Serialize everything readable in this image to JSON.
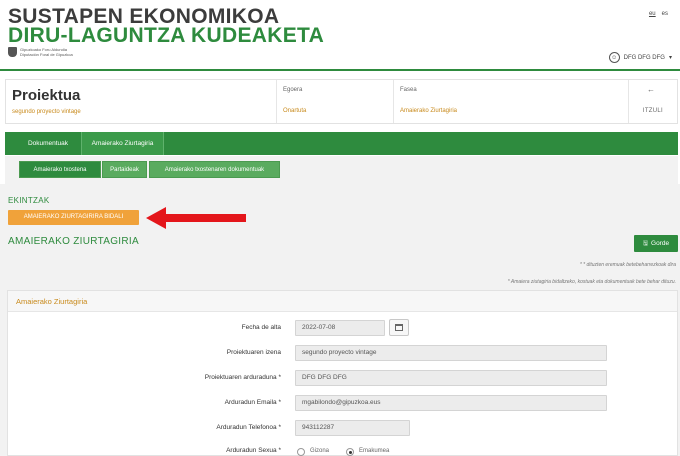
{
  "header": {
    "title_line1": "SUSTAPEN EKONOMIKOA",
    "title_line2": "DIRU-LAGUNTZA KUDEAKETA",
    "logo_line1": "Gipuzkoako Foru Aldundia",
    "logo_line2": "Diputación Foral de Gipuzkoa",
    "lang_eu": "eu",
    "lang_es": "es",
    "user_name": "DFG DFG DFG",
    "user_caret": "▾"
  },
  "project": {
    "title": "Proiektua",
    "subtitle": "segundo proyecto vintage",
    "state_label": "Egoera",
    "state_value": "Onartuta",
    "phase_label": "Fasea",
    "phase_value": "Amaierako Ziurtagiria",
    "back_arrow": "←",
    "back_label": "ITZULI"
  },
  "tabs": [
    {
      "label": "Dokumentuak",
      "active": false
    },
    {
      "label": "Amaierako Ziurtagiria",
      "active": true
    }
  ],
  "subtabs": [
    {
      "label": "Amaierako txostena",
      "active": true
    },
    {
      "label": "Partaideak",
      "active": false
    },
    {
      "label": "Amaierako txostenaren dokumentuak",
      "active": false
    }
  ],
  "actions": {
    "heading": "EKINTZAK",
    "send_button": "AMAIERAKO ZIURTAGIRIRA BIDALI"
  },
  "section": {
    "title": "AMAIERAKO ZIURTAGIRIA",
    "save_icon": "🖫",
    "save_label": "Gorde",
    "note_required": "* * dituzten eremuak betebeharrezkoak dira",
    "note_docs": "* Amaiera ziutagiria bidaltzeko, kostuak eta dokumentuak bete behar dituzu."
  },
  "form": {
    "panel_title": "Amaierako Ziurtagiria",
    "fields": [
      {
        "label": "Fecha de alta",
        "value": "2022-07-08"
      },
      {
        "label": "Proiektuaren izena",
        "value": "segundo proyecto vintage"
      },
      {
        "label": "Proiektuaren arduraduna *",
        "value": "DFG DFG DFG"
      },
      {
        "label": "Arduradun Emaila *",
        "value": "mgabilondo@gipuzkoa.eus"
      },
      {
        "label": "Arduradun Telefonoa *",
        "value": "943112287"
      },
      {
        "label": "Arduradun Sexua *",
        "value": ""
      }
    ],
    "sex_options": [
      {
        "label": "Gizona",
        "checked": false
      },
      {
        "label": "Emakumea",
        "checked": true
      }
    ]
  },
  "colors": {
    "brand_green": "#2e8b3e",
    "accent_orange": "#f0a23a",
    "arrow_red": "#e4161b",
    "value_gold": "#c88a1c"
  }
}
